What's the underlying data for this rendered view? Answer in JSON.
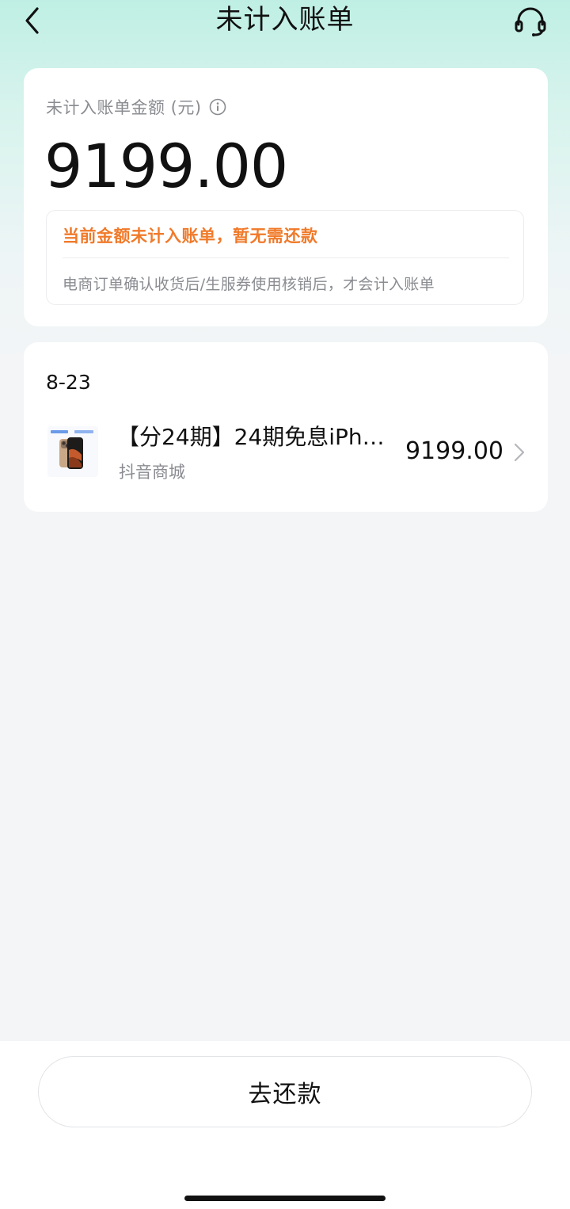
{
  "header": {
    "title": "未计入账单",
    "back_icon": "chevron-left-icon",
    "support_icon": "headset-icon"
  },
  "summary": {
    "label": "未计入账单金额 (元)",
    "info_icon": "info-icon",
    "amount": "9199.00",
    "notice_title": "当前金额未计入账单，暂无需还款",
    "notice_desc": "电商订单确认收货后/生服券使用核销后，才会计入账单",
    "notice_color": "#f07a2a"
  },
  "orders": [
    {
      "date": "8-23",
      "items": [
        {
          "name": "【分24期】24期免息iPh…",
          "store": "抖音商城",
          "price": "9199.00",
          "thumb": "phone-product-image"
        }
      ]
    }
  ],
  "actions": {
    "repay_label": "去还款"
  }
}
